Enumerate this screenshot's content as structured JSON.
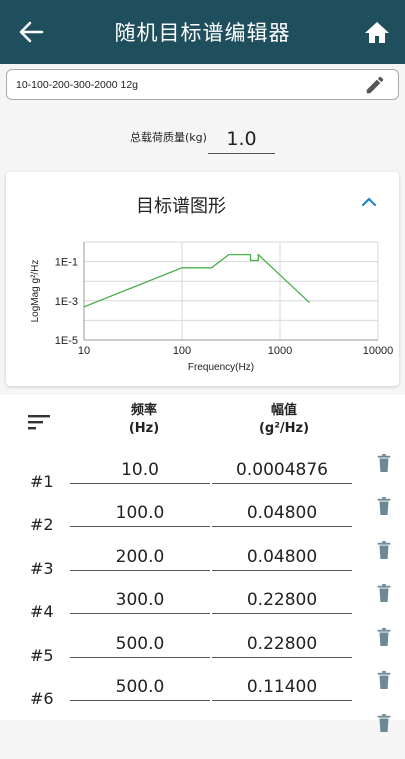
{
  "appbar": {
    "title": "随机目标谱编辑器",
    "back_icon": "arrow-left-icon",
    "home_icon": "home-icon"
  },
  "profile_name": {
    "value": "10-100-200-300-2000 12g",
    "edit_icon": "pencil-icon"
  },
  "mass": {
    "label": "总载荷质量(kg)",
    "value": "1.0"
  },
  "chart_card": {
    "title": "目标谱图形",
    "collapse_icon": "chevron-up-icon"
  },
  "chart_data": {
    "type": "line",
    "xlabel": "Frequency(Hz)",
    "ylabel": "LogMag g²/Hz",
    "x_scale": "log",
    "y_scale": "log",
    "xlim": [
      10,
      10000
    ],
    "ylim": [
      1e-05,
      1
    ],
    "x_ticks": [
      "10",
      "100",
      "1000",
      "10000"
    ],
    "y_ticks": [
      "1E-1",
      "1E-3",
      "1E-5"
    ],
    "grid": true,
    "line_color": "#4caf50",
    "series": [
      {
        "x": [
          10,
          100,
          200,
          300,
          500,
          500,
          600,
          600,
          2000
        ],
        "y": [
          0.0004876,
          0.048,
          0.048,
          0.228,
          0.228,
          0.114,
          0.114,
          0.228,
          0.0008
        ]
      }
    ]
  },
  "table": {
    "sort_icon": "sort-icon",
    "freq_header": "频率",
    "freq_unit": "(Hz)",
    "amp_header": "幅值",
    "amp_unit": "(g²/Hz)",
    "delete_icon": "trash-icon",
    "rows": [
      {
        "index": "#1",
        "freq": "10.0",
        "amp": "0.0004876"
      },
      {
        "index": "#2",
        "freq": "100.0",
        "amp": "0.04800"
      },
      {
        "index": "#3",
        "freq": "200.0",
        "amp": "0.04800"
      },
      {
        "index": "#4",
        "freq": "300.0",
        "amp": "0.22800"
      },
      {
        "index": "#5",
        "freq": "500.0",
        "amp": "0.22800"
      },
      {
        "index": "#6",
        "freq": "500.0",
        "amp": "0.11400"
      }
    ]
  }
}
